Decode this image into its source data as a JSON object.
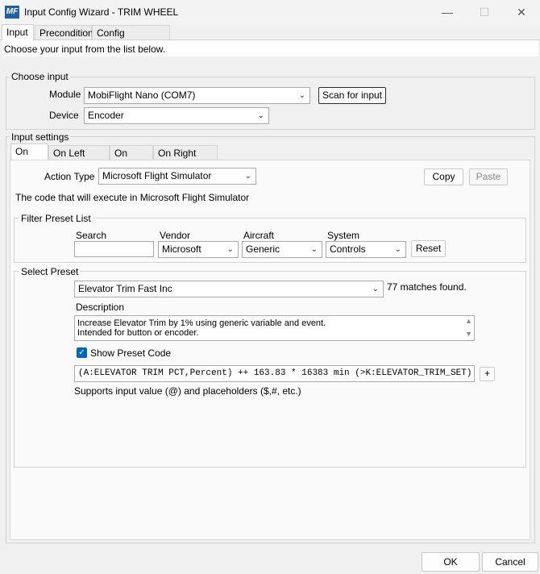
{
  "window": {
    "app_icon_text": "MF",
    "title": "Input Config Wizard - TRIM WHEEL",
    "minimize_glyph": "—",
    "maximize_glyph": "☐",
    "close_glyph": "✕"
  },
  "tabs": [
    {
      "label": "Input"
    },
    {
      "label": "Precondition"
    },
    {
      "label": "Config References"
    }
  ],
  "instructions": "Choose your input from the list below.",
  "choose_input": {
    "title": "Choose input",
    "module_label": "Module",
    "module_value": "MobiFlight Nano (COM7)",
    "scan_button": "Scan for input",
    "device_label": "Device",
    "device_value": "Encoder"
  },
  "input_settings": {
    "title": "Input settings",
    "subtabs": [
      {
        "label": "On Left"
      },
      {
        "label": "On Left (Fast)"
      },
      {
        "label": "On Right"
      },
      {
        "label": "On Right (Fast)"
      }
    ],
    "action_type_label": "Action Type",
    "action_type_value": "Microsoft Flight Simulator",
    "copy_button": "Copy",
    "paste_button": "Paste",
    "code_info": "The code that will execute in Microsoft Flight Simulator"
  },
  "filter": {
    "title": "Filter Preset List",
    "search_label": "Search",
    "search_value": "",
    "vendor_label": "Vendor",
    "vendor_value": "Microsoft",
    "aircraft_label": "Aircraft",
    "aircraft_value": "Generic",
    "system_label": "System",
    "system_value": "Controls",
    "reset_button": "Reset"
  },
  "preset": {
    "title": "Select Preset",
    "selected": "Elevator Trim Fast Inc",
    "matches": "77 matches found.",
    "description_label": "Description",
    "description_line1": "Increase Elevator Trim by 1% using generic variable and event.",
    "description_line2": "Intended for button or encoder.",
    "show_code_label": "Show Preset Code",
    "show_code_checked": true,
    "code": "(A:ELEVATOR TRIM PCT,Percent) ++ 163.83 * 16383 min (>K:ELEVATOR_TRIM_SET)",
    "plus_button": "+",
    "support_text": "Supports input value (@) and placeholders ($,#, etc.)"
  },
  "footer": {
    "ok_button": "OK",
    "cancel_button": "Cancel"
  },
  "colors": {
    "accent": "#0067c0",
    "app_icon_bg": "#1f5fa8"
  }
}
